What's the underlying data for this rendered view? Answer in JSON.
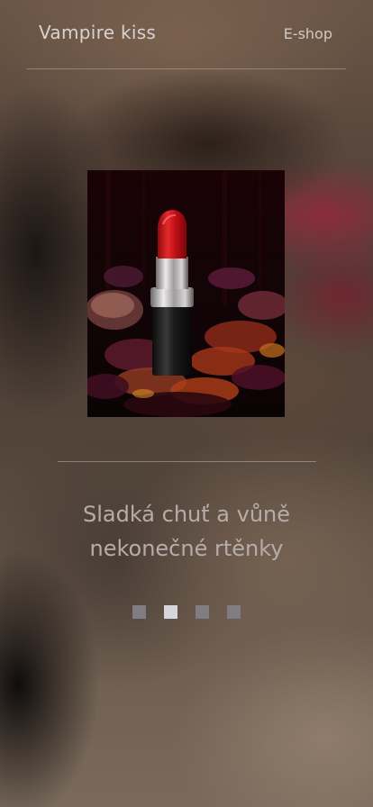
{
  "header": {
    "brand": "Vampire kiss",
    "nav_link": "E-shop"
  },
  "hero": {
    "image_icon": "red-lipstick-image",
    "tagline_line1": "Sladká chuť a vůně",
    "tagline_line2": "nekonečné rtěnky"
  },
  "carousel": {
    "slide_count": 4,
    "active_index": 1
  },
  "colors": {
    "lipstick_red": "#d0141c",
    "dot_active": "#d7d5db",
    "dot_inactive": "#7f7c82"
  }
}
